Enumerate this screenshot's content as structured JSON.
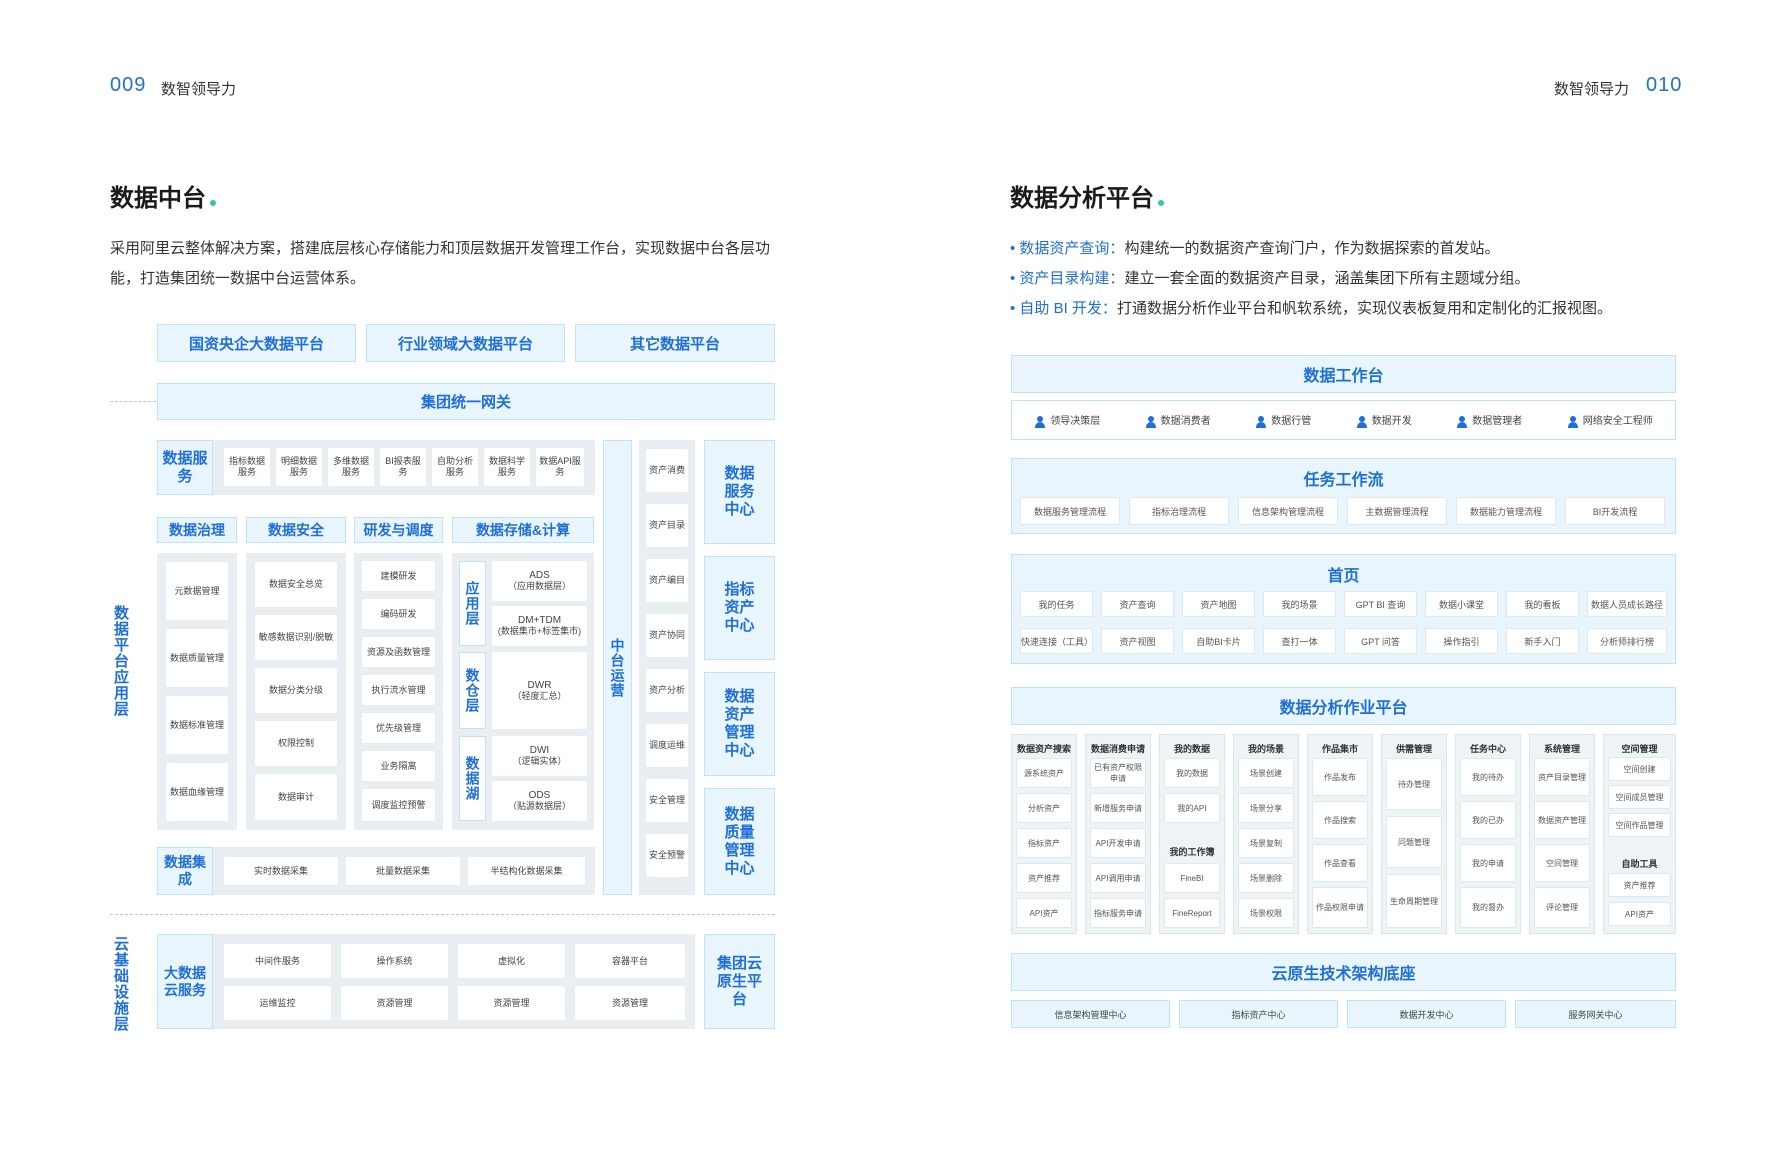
{
  "header": {
    "left_num": "009",
    "left_label": "数智领导力",
    "right_label": "数智领导力",
    "right_num": "010"
  },
  "left": {
    "title": "数据中台",
    "desc": "采用阿里云整体解决方案，搭建底层核心存储能力和顶层数据开发管理工作台，实现数据中台各层功能，打造集团统一数据中台运营体系。",
    "top_platforms": [
      "国资央企大数据平台",
      "行业领域大数据平台",
      "其它数据平台"
    ],
    "gateway": "集团统一网关",
    "app_layer_label": "数据平台应用层",
    "data_service": {
      "label": "数据服务",
      "items": [
        "指标数据服务",
        "明细数据服务",
        "多维数据服务",
        "BI报表服务",
        "自助分析服务",
        "数据科学服务",
        "数据API服务"
      ]
    },
    "sections": {
      "governance": {
        "label": "数据治理",
        "items": [
          "元数据管理",
          "数据质量管理",
          "数据标准管理",
          "数据血缘管理"
        ]
      },
      "security": {
        "label": "数据安全",
        "items": [
          "数据安全总览",
          "敏感数据识别/脱敏",
          "数据分类分级",
          "权限控制",
          "数据审计"
        ]
      },
      "rnd": {
        "label": "研发与调度",
        "items": [
          "建模研发",
          "编码研发",
          "资源及函数管理",
          "执行流水管理",
          "优先级管理",
          "业务隔离",
          "调度监控预警"
        ]
      },
      "storage": {
        "label": "数据存储&计算",
        "layers": [
          {
            "name": "应用层",
            "items": [
              {
                "l1": "ADS",
                "l2": "（应用数据层）"
              },
              {
                "l1": "DM+TDM",
                "l2": "(数据集市+标签集市)"
              }
            ]
          },
          {
            "name": "数仓层",
            "items": [
              {
                "l1": "DWR",
                "l2": "（轻度汇总）"
              }
            ]
          },
          {
            "name": "数据湖",
            "items": [
              {
                "l1": "DWI",
                "l2": "（逻辑实体）"
              },
              {
                "l1": "ODS",
                "l2": "（贴源数据层）"
              }
            ]
          }
        ]
      }
    },
    "integration": {
      "label": "数据集成",
      "items": [
        "实时数据采集",
        "批量数据采集",
        "半结构化数据采集"
      ]
    },
    "ops": "中台运营",
    "asset_ops": [
      "资产消费",
      "资产目录",
      "资产编目",
      "资产协同",
      "资产分析",
      "调度运维",
      "安全管理",
      "安全预警"
    ],
    "centers": [
      "数据服务中心",
      "指标资产中心",
      "数据资产管理中心",
      "数据质量管理中心"
    ],
    "infra_label": "云基础设施层",
    "bigdata": {
      "label": "大数据云服务",
      "items": [
        "中间件服务",
        "操作系统",
        "虚拟化",
        "容器平台",
        "运维监控",
        "资源管理",
        "资源管理",
        "资源管理"
      ]
    },
    "cloud_native": "集团云原生平台"
  },
  "right": {
    "title": "数据分析平台",
    "bullets": [
      {
        "key": "数据资产查询：",
        "text": "构建统一的数据资产查询门户，作为数据探索的首发站。"
      },
      {
        "key": "资产目录构建：",
        "text": "建立一套全面的数据资产目录，涵盖集团下所有主题域分组。"
      },
      {
        "key": "自助 BI 开发：",
        "text": "打通数据分析作业平台和帆软系统，实现仪表板复用和定制化的汇报视图。"
      }
    ],
    "workbench": "数据工作台",
    "roles": [
      "领导决策层",
      "数据消费者",
      "数据行管",
      "数据开发",
      "数据管理者",
      "网络安全工程师"
    ],
    "workflow": {
      "label": "任务工作流",
      "items": [
        "数据服务管理流程",
        "指标治理流程",
        "信息架构管理流程",
        "主数据管理流程",
        "数据能力管理流程",
        "BI开发流程"
      ]
    },
    "home": {
      "label": "首页",
      "row1": [
        "我的任务",
        "资产查询",
        "资产地图",
        "我的场景",
        "GPT BI 查询",
        "数据小课堂",
        "我的看板",
        "数据人员成长路径"
      ],
      "row2": [
        "快速连接（工具）",
        "资产视图",
        "自助BI卡片",
        "查打一体",
        "GPT 问答",
        "操作指引",
        "新手入门",
        "分析师排行榜"
      ]
    },
    "platform": {
      "label": "数据分析作业平台",
      "columns": [
        {
          "title": "数据资产搜索",
          "items": [
            "源系统资产",
            "分析资产",
            "指标资产",
            "资产推荐",
            "API资产"
          ]
        },
        {
          "title": "数据消费申请",
          "items": [
            "已有资产权限申请",
            "新增服务申请",
            "API开发申请",
            "API调用申请",
            "指标服务申请"
          ]
        },
        {
          "title": "我的数据",
          "items": [
            "我的数据",
            "我的API"
          ],
          "sub_title": "我的工作簿",
          "sub_items": [
            "FineBI",
            "FineReport"
          ]
        },
        {
          "title": "我的场景",
          "items": [
            "场景创建",
            "场景分享",
            "场景复制",
            "场景删除",
            "场景权限"
          ]
        },
        {
          "title": "作品集市",
          "items": [
            "作品发布",
            "作品搜索",
            "作品查看",
            "作品权限申请"
          ]
        },
        {
          "title": "供需管理",
          "items": [
            "待办管理",
            "问题管理",
            "生命周期管理"
          ]
        },
        {
          "title": "任务中心",
          "items": [
            "我的待办",
            "我的已办",
            "我的申请",
            "我的督办"
          ]
        },
        {
          "title": "系统管理",
          "items": [
            "资产目录管理",
            "数据资产管理",
            "空间管理",
            "评论管理"
          ]
        },
        {
          "title": "空间管理",
          "items": [
            "空间创建",
            "空间成员管理",
            "空间作品管理"
          ],
          "sub_title": "自助工具",
          "sub_items": [
            "资产推荐",
            "API资产"
          ]
        }
      ]
    },
    "cloud_base": {
      "label": "云原生技术架构底座",
      "items": [
        "信息架构管理中心",
        "指标资产中心",
        "数据开发中心",
        "服务网关中心"
      ]
    }
  }
}
